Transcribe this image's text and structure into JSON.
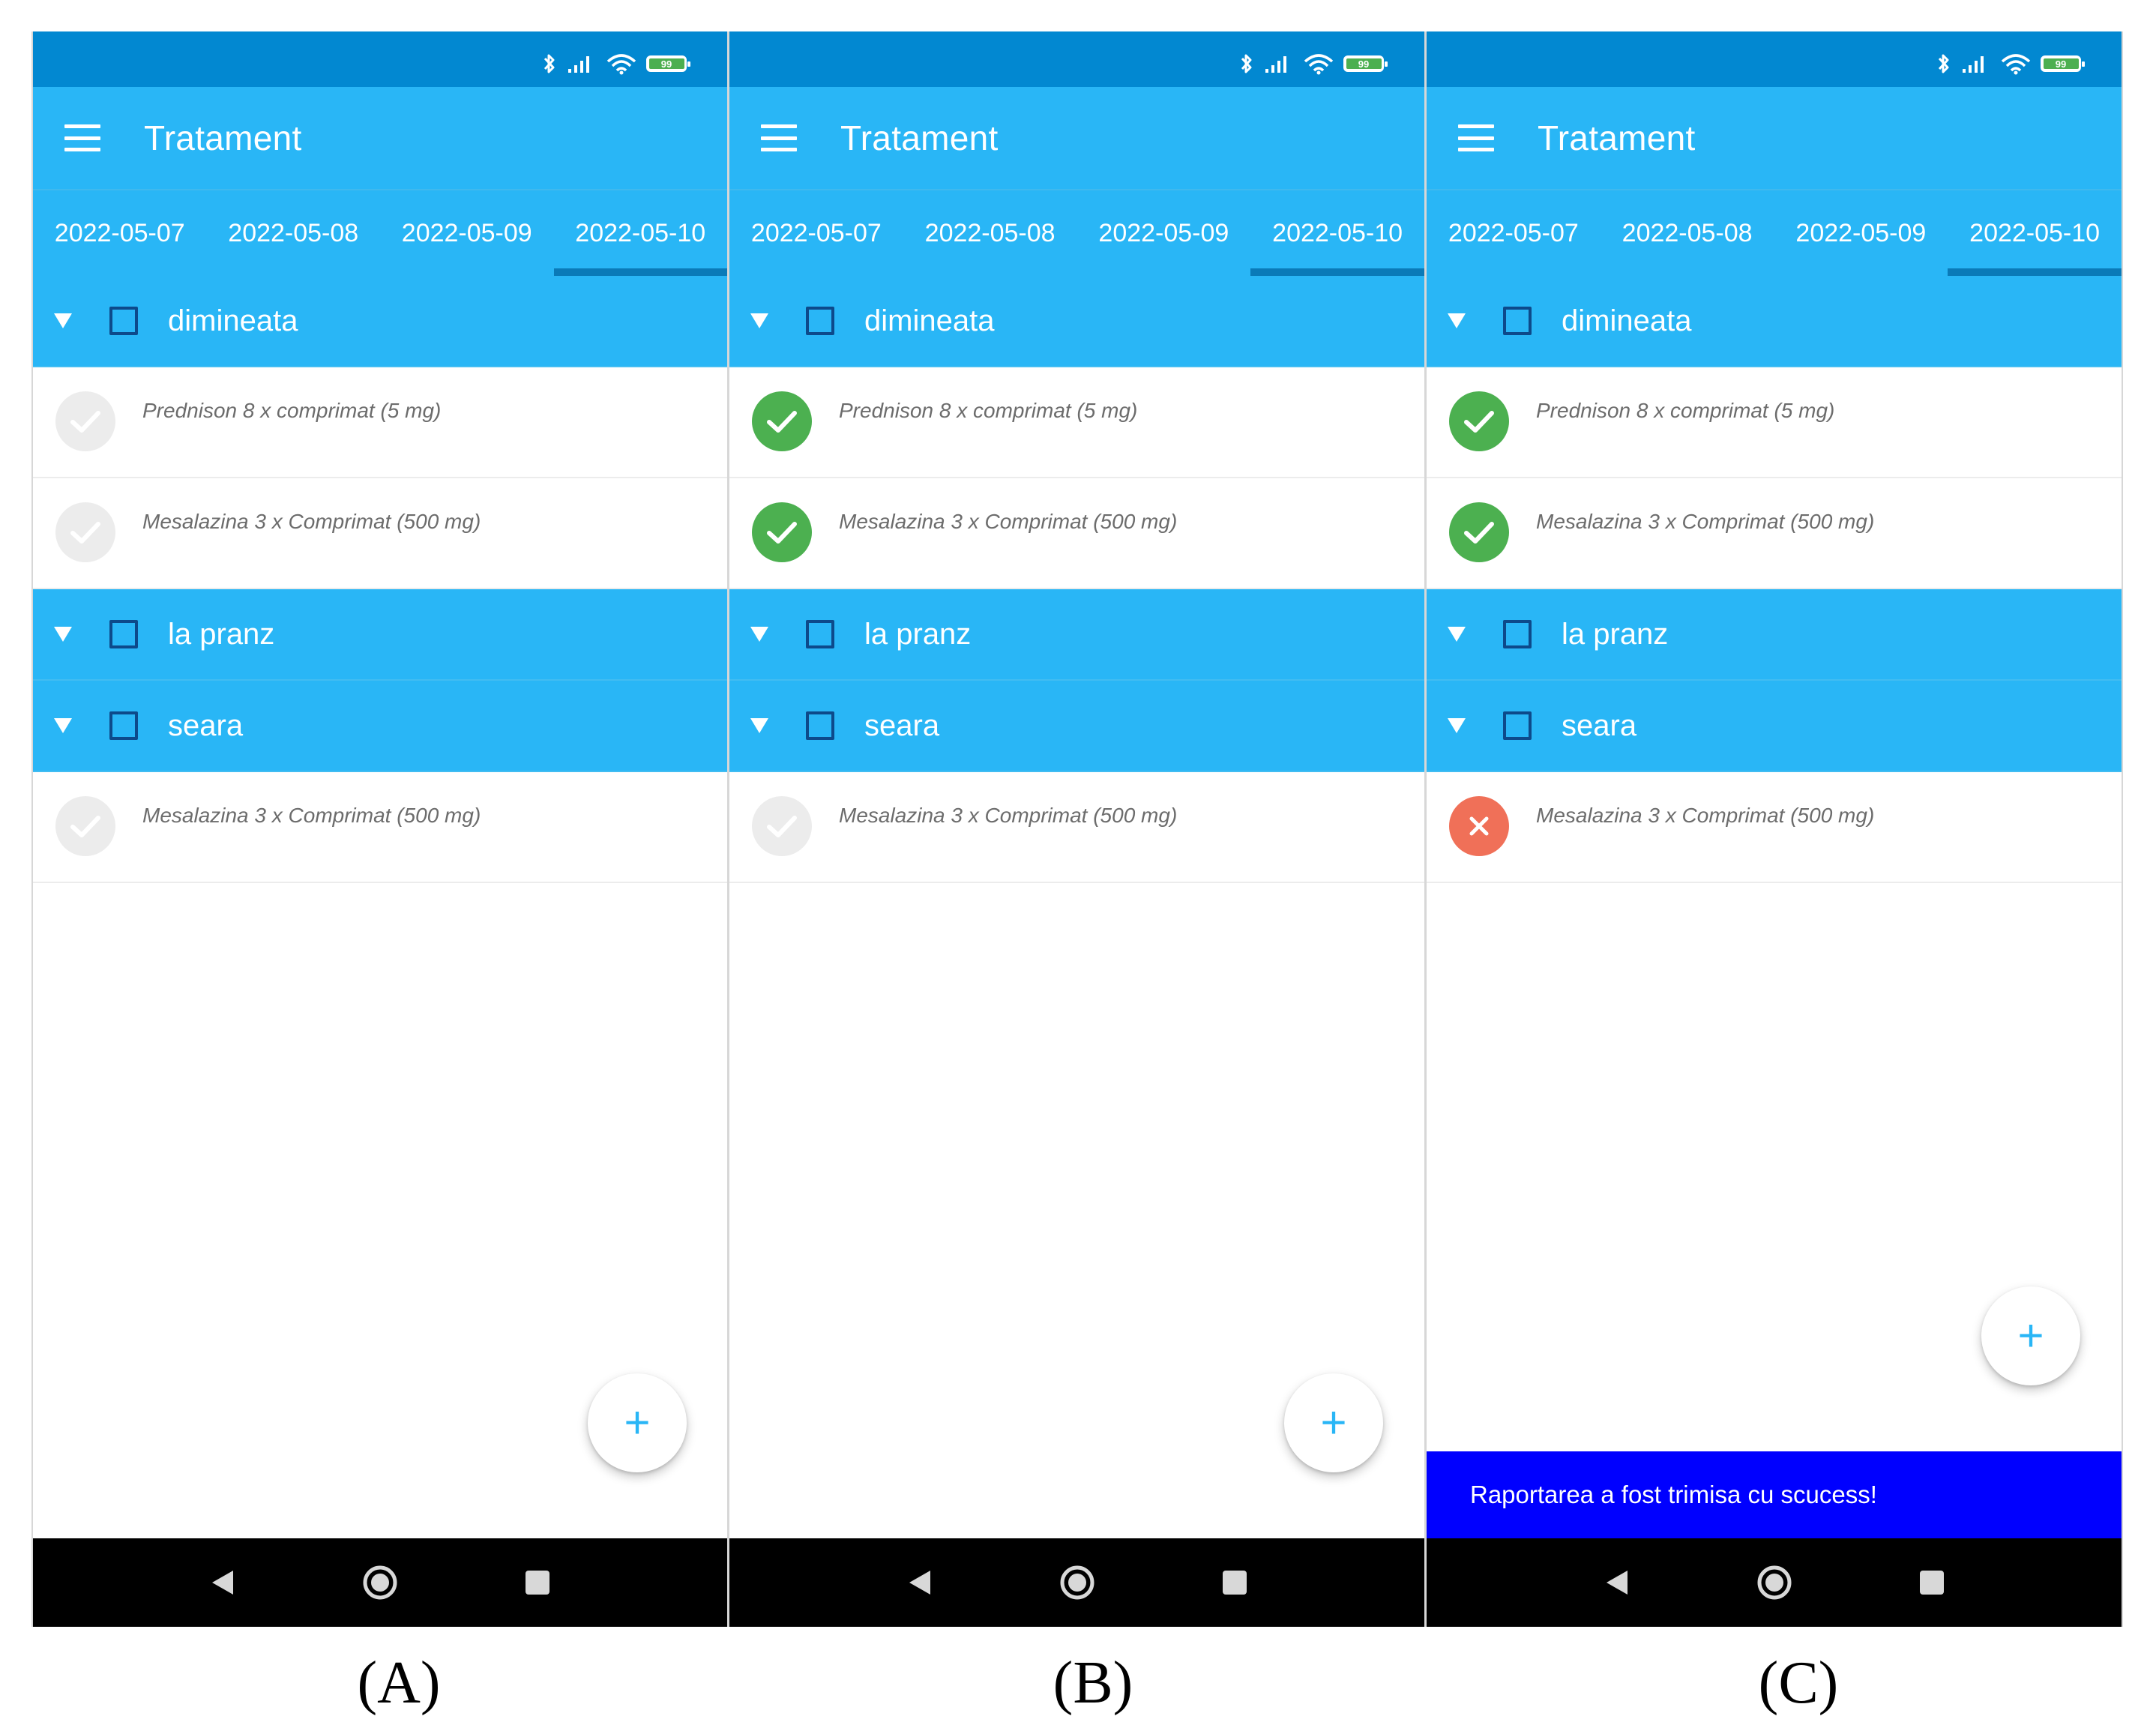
{
  "app": {
    "title": "Tratament"
  },
  "battery": "99",
  "tabs": [
    "2022-05-07",
    "2022-05-08",
    "2022-05-09",
    "2022-05-10"
  ],
  "active_tab": "2022-05-10",
  "colors": {
    "statusbar": "#0288d1",
    "primary": "#29b6f6",
    "indicator": "#0a7ab8",
    "done": "#4cb050",
    "missed": "#f07058",
    "pending": "#ececec",
    "snackbar": "#0000ff"
  },
  "icons": {
    "menu": "hamburger-icon",
    "bluetooth": "bluetooth-icon",
    "signal": "signal-icon",
    "wifi": "wifi-icon",
    "battery": "battery-icon",
    "group": "caret-down-icon",
    "done": "check-icon",
    "pending": "check-icon",
    "missed": "cross-icon",
    "fab": "plus-icon",
    "nav_back": "back-icon",
    "nav_home": "home-icon",
    "nav_recents": "recents-icon"
  },
  "fab_label": "+",
  "panels": [
    {
      "caption": "(A)",
      "groups": [
        {
          "title": "dimineata",
          "items": [
            {
              "text": "Prednison 8 x comprimat (5 mg)",
              "status": "pending"
            },
            {
              "text": "Mesalazina 3 x Comprimat (500 mg)",
              "status": "pending"
            }
          ]
        },
        {
          "title": "la pranz",
          "items": []
        },
        {
          "title": "seara",
          "items": [
            {
              "text": "Mesalazina 3 x Comprimat (500 mg)",
              "status": "pending"
            }
          ]
        }
      ],
      "snackbar": null
    },
    {
      "caption": "(B)",
      "groups": [
        {
          "title": "dimineata",
          "items": [
            {
              "text": "Prednison 8 x comprimat (5 mg)",
              "status": "done"
            },
            {
              "text": "Mesalazina 3 x Comprimat (500 mg)",
              "status": "done"
            }
          ]
        },
        {
          "title": "la pranz",
          "items": []
        },
        {
          "title": "seara",
          "items": [
            {
              "text": "Mesalazina 3 x Comprimat (500 mg)",
              "status": "pending"
            }
          ]
        }
      ],
      "snackbar": null
    },
    {
      "caption": "(C)",
      "groups": [
        {
          "title": "dimineata",
          "items": [
            {
              "text": "Prednison 8 x comprimat (5 mg)",
              "status": "done"
            },
            {
              "text": "Mesalazina 3 x Comprimat (500 mg)",
              "status": "done"
            }
          ]
        },
        {
          "title": "la pranz",
          "items": []
        },
        {
          "title": "seara",
          "items": [
            {
              "text": "Mesalazina 3 x Comprimat (500 mg)",
              "status": "missed"
            }
          ]
        }
      ],
      "snackbar": "Raportarea a fost trimisa cu scucess!"
    }
  ]
}
